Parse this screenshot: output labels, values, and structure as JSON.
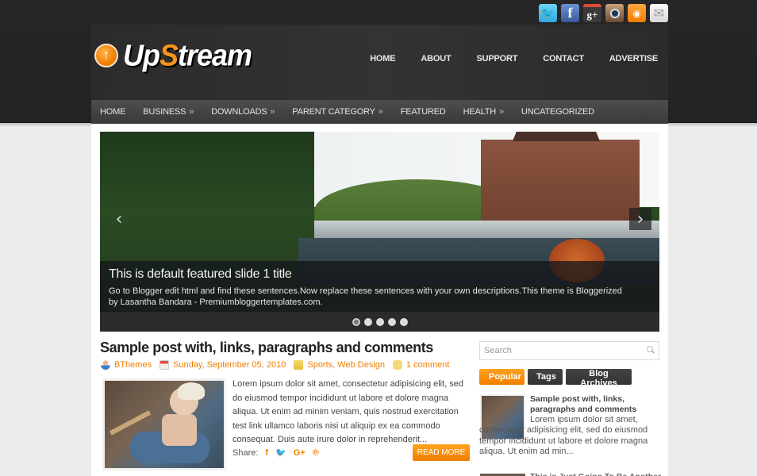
{
  "social": [
    {
      "name": "twitter",
      "glyph": "🐦"
    },
    {
      "name": "facebook",
      "glyph": "f"
    },
    {
      "name": "google-plus",
      "glyph": "g+"
    },
    {
      "name": "instagram",
      "glyph": ""
    },
    {
      "name": "rss",
      "glyph": "))"
    },
    {
      "name": "email",
      "glyph": "✉"
    }
  ],
  "logo": {
    "prefix": "Up",
    "accent": "S",
    "suffix": "tream",
    "icon": "↑"
  },
  "top_nav": [
    "HOME",
    "ABOUT",
    "SUPPORT",
    "CONTACT",
    "ADVERTISE"
  ],
  "main_nav": [
    {
      "label": "HOME",
      "has_sub": false
    },
    {
      "label": "BUSINESS",
      "has_sub": true
    },
    {
      "label": "DOWNLOADS",
      "has_sub": true
    },
    {
      "label": "PARENT CATEGORY",
      "has_sub": true
    },
    {
      "label": "FEATURED",
      "has_sub": false
    },
    {
      "label": "HEALTH",
      "has_sub": true
    },
    {
      "label": "UNCATEGORIZED",
      "has_sub": false
    }
  ],
  "submenu_arrow": "»",
  "slider": {
    "title": "This is default featured slide 1 title",
    "text": "Go to Blogger edit html and find these sentences.Now replace these sentences with your own descriptions.This theme is Bloggerized by Lasantha Bandara - Premiumbloggertemplates.com.",
    "prev": "‹",
    "next": "›",
    "slide_count": 5,
    "active_slide": 1
  },
  "post": {
    "title": "Sample post with, links, paragraphs and comments",
    "author": "BThemes",
    "date": "Sunday, September 05, 2010",
    "labels": "Sports, Web Design",
    "comments": "1 comment",
    "excerpt": "Lorem ipsum dolor sit amet, consectetur adipisicing elit, sed do eiusmod tempor incididunt ut labore et dolore magna aliqua. Ut enim ad minim veniam, quis nostrud exercitation test link ullamco laboris nisi ut aliquip ex ea commodo consequat. Duis aute irure dolor in reprehenderit...",
    "share_label": "Share:",
    "share_icons": [
      "f",
      "🐦",
      "G+",
      "℗"
    ],
    "read_more": "READ MORE"
  },
  "sidebar": {
    "search_placeholder": "Search",
    "tabs": [
      "Popular",
      "Tags",
      "Blog Archives"
    ],
    "popular": {
      "title": "Sample post with, links, paragraphs and comments",
      "text": "Lorem ipsum dolor sit amet, consectetur adipisicing elit, sed do eiusmod tempor incididunt ut labore et dolore magna aliqua. Ut enim ad min..."
    },
    "next_popular_title": "This is Just Going To Be Another..."
  }
}
